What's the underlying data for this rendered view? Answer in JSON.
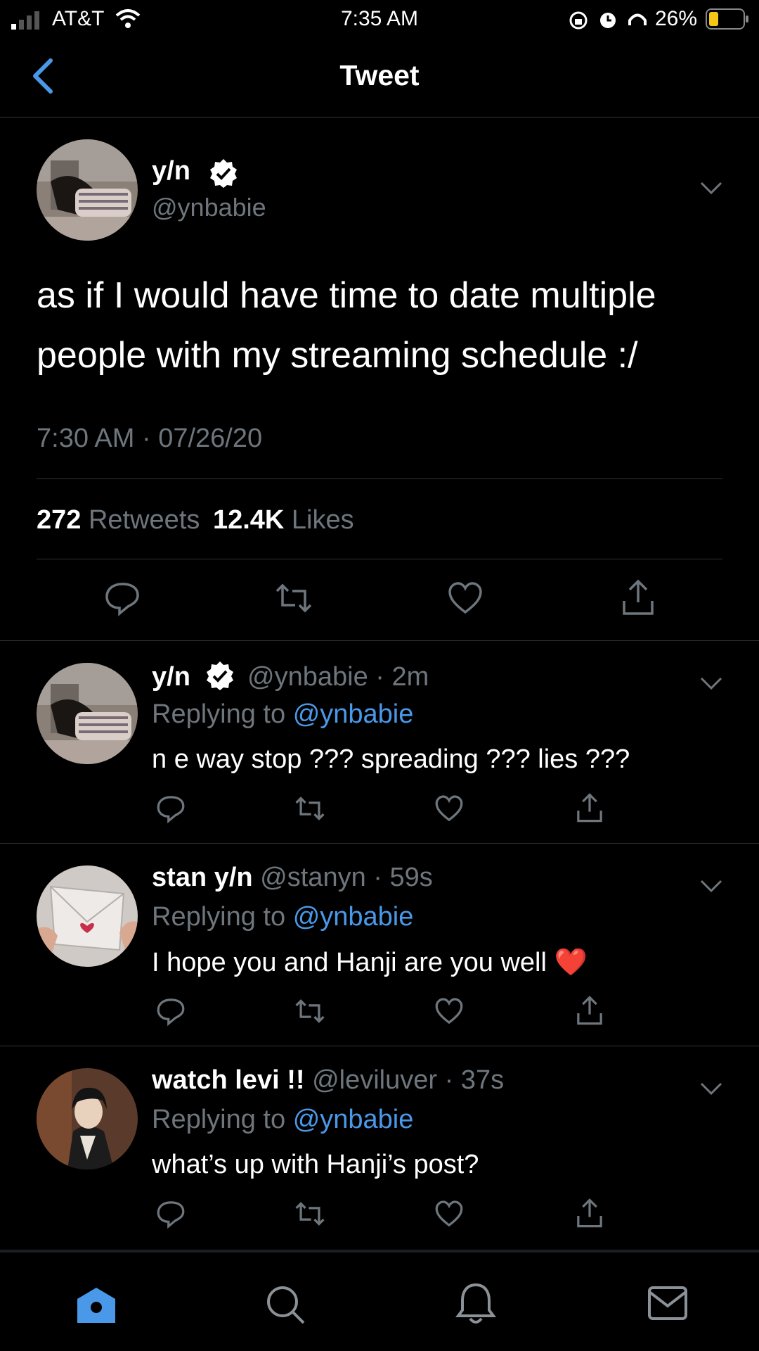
{
  "status_bar": {
    "carrier": "AT&T",
    "time": "7:35 AM",
    "battery": "26%"
  },
  "header": {
    "title": "Tweet"
  },
  "main_tweet": {
    "name": "y/n",
    "handle": "@ynbabie",
    "text_line1": "as if I would have time to date multiple",
    "text_line2": "people with my streaming schedule :/",
    "timestamp": "7:30 AM · 07/26/20",
    "retweets_count": "272",
    "retweets_label": "Retweets",
    "likes_count": "12.4K",
    "likes_label": "Likes"
  },
  "replies": [
    {
      "name": "y/n",
      "handle": "@ynbabie",
      "time": "· 2m",
      "replying_prefix": "Replying to",
      "replying_to": "@ynbabie",
      "text": "n e way stop ??? spreading ??? lies ???"
    },
    {
      "name": "stan y/n",
      "handle": "@stanyn",
      "time": "· 59s",
      "replying_prefix": "Replying to",
      "replying_to": "@ynbabie",
      "text": "I hope you and Hanji are you well ❤️"
    },
    {
      "name": "watch levi !!",
      "handle": "@leviluver",
      "time": "· 37s",
      "replying_prefix": "Replying to",
      "replying_to": "@ynbabie",
      "text": "what’s up with Hanji’s post?"
    }
  ],
  "tab_bar": {
    "items": [
      "home-icon",
      "search-icon",
      "notifications-icon",
      "messages-icon"
    ],
    "active": "home-icon"
  },
  "colors": {
    "accent": "#4a99e9",
    "muted": "#6e767d",
    "background": "#000000",
    "battery_fill": "#f5c518"
  }
}
